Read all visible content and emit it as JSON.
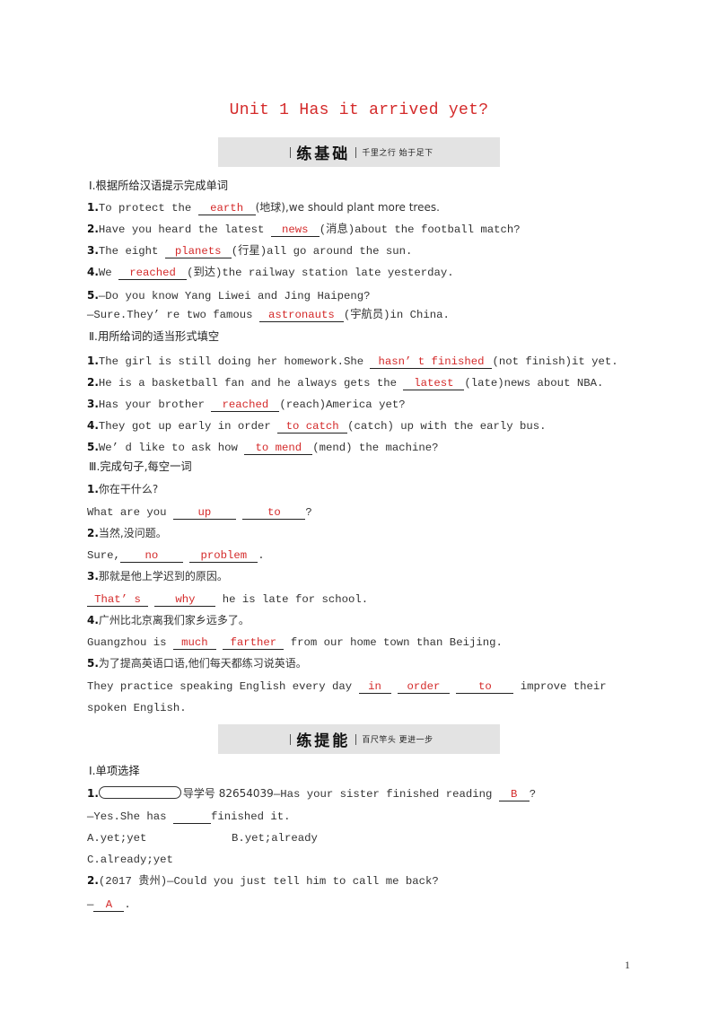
{
  "title": "Unit 1  Has it arrived yet?",
  "banner1": {
    "main": "练基础",
    "sub": "千里之行  始于足下"
  },
  "banner2": {
    "main": "练提能",
    "sub": "百尺竿头  更进一步"
  },
  "part1": {
    "heading": "Ⅰ.根据所给汉语提示完成单词",
    "items": [
      {
        "num": "1.",
        "before": "To protect the ",
        "answer": "earth",
        "after": "(地球),we should plant more trees."
      },
      {
        "num": "2.",
        "before": "Have you heard the latest ",
        "answer": "news",
        "after": "(消息)about the football match?"
      },
      {
        "num": "3.",
        "before": "The eight ",
        "answer": "planets",
        "after": "(行星)all go around the sun."
      },
      {
        "num": "4.",
        "before": "We ",
        "answer": "reached",
        "after": "(到达)the railway station late yesterday."
      },
      {
        "num": "5.",
        "before": "—Do you know Yang Liwei and Jing Haipeng?"
      },
      {
        "before": "—Sure.They’ re two famous ",
        "answer": "astronauts",
        "after": "(宇航员)in China."
      }
    ]
  },
  "part2": {
    "heading": "Ⅱ.用所给词的适当形式填空",
    "items": [
      {
        "num": "1.",
        "before": "The girl is still doing her homework.She ",
        "answer": "hasn’ t finished",
        "after": "(not finish)it yet."
      },
      {
        "num": "2.",
        "before": "He is a basketball fan and he always gets the ",
        "answer": "latest",
        "after": "(late)news about NBA."
      },
      {
        "num": "3.",
        "before": "Has your brother ",
        "answer": "reached",
        "after": "(reach)America yet?"
      },
      {
        "num": "4.",
        "before": "They got up early in order ",
        "answer": "to catch",
        "after": "(catch) up with the early bus."
      },
      {
        "num": "5.",
        "before": "We’ d like to ask how ",
        "answer": "to mend",
        "after": "(mend) the machine?"
      }
    ]
  },
  "part3": {
    "heading": "Ⅲ.完成句子,每空一词",
    "items": [
      {
        "num": "1.",
        "prompt": "你在干什么?",
        "before": "What are you ",
        "answers": [
          "up",
          "to"
        ],
        "after": "?"
      },
      {
        "num": "2.",
        "prompt": "当然,没问题。",
        "before": "Sure,",
        "answers": [
          "no",
          "problem"
        ],
        "after": "."
      },
      {
        "num": "3.",
        "prompt": "那就是他上学迟到的原因。",
        "before": "",
        "answers": [
          "That’ s",
          "why"
        ],
        "after": " he is late for school."
      },
      {
        "num": "4.",
        "prompt": "广州比北京离我们家乡远多了。",
        "before": "Guangzhou is ",
        "answers": [
          "much",
          "farther"
        ],
        "after": " from our home town than Beijing."
      },
      {
        "num": "5.",
        "prompt": "为了提高英语口语,他们每天都练习说英语。",
        "before": "They practice speaking English every day ",
        "answers": [
          "in",
          "order",
          "to"
        ],
        "after": " improve their",
        "cont": "spoken English."
      }
    ]
  },
  "part4": {
    "heading": "Ⅰ.单项选择",
    "q1": {
      "num": "1.",
      "guide": "导学号 82654039",
      "text": "—Has your sister finished reading ",
      "answer": "B",
      "after": "?",
      "line2": "—Yes.She has ",
      "line2_after": "finished it.",
      "options": [
        "A.yet;yet",
        "B.yet;already",
        "C.already;yet"
      ]
    },
    "q2": {
      "num": "2.",
      "text": "(2017 贵州)—Could you just tell him to call me back?",
      "line2": "—",
      "answer": "A",
      "after": "."
    }
  },
  "page_number": "1"
}
